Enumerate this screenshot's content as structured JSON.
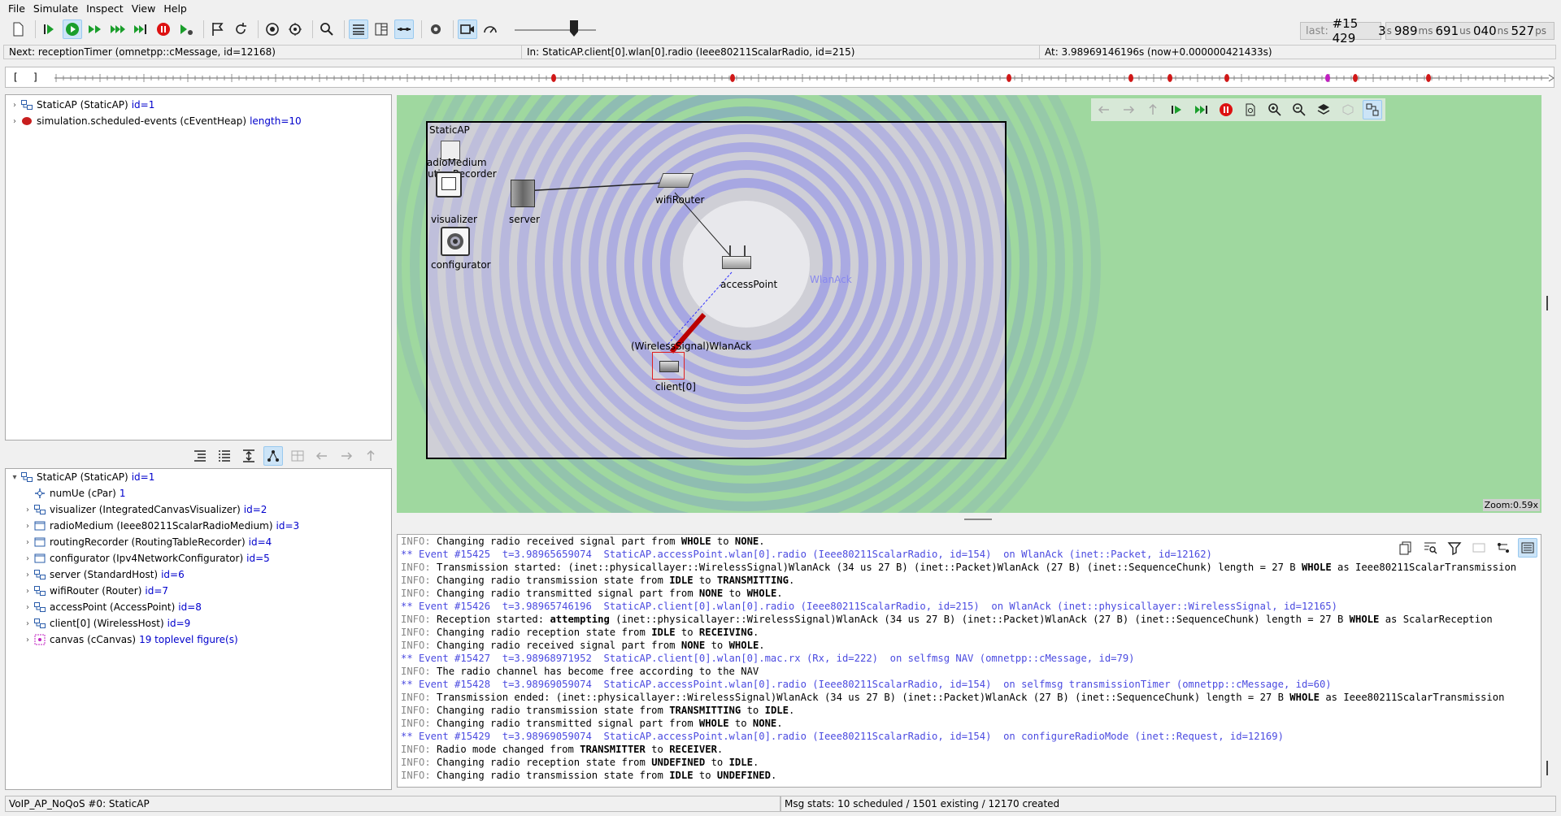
{
  "menu": [
    "File",
    "Simulate",
    "Inspect",
    "View",
    "Help"
  ],
  "counters": {
    "last_label": "last: ",
    "last_value": "#15 429",
    "t_s": "3",
    "t_ms": "989",
    "t_us": "691",
    "t_ns": "040",
    "t_ps": "527",
    "u_s": "s",
    "u_ms": "ms",
    "u_us": "us",
    "u_ns": "ns",
    "u_ps": "ps"
  },
  "status": {
    "next": "Next: receptionTimer (omnetpp::cMessage, id=12168)",
    "in": "In: StaticAP.client[0].wlan[0].radio (Ieee80211ScalarRadio, id=215)",
    "at": "At: 3.98969146196s (now+0.000000421433s)"
  },
  "timeline": {
    "open": "[",
    "close": "]"
  },
  "top_tree": [
    {
      "label": "StaticAP (StaticAP)",
      "id": "id=1",
      "icon": "module-icon"
    },
    {
      "label": "simulation.scheduled-events (cEventHeap)",
      "id": "length=10",
      "icon": "event-heap-icon"
    }
  ],
  "object_tree": {
    "root": {
      "label": "StaticAP (StaticAP)",
      "id": "id=1"
    },
    "children": [
      {
        "label": "numUe (cPar)",
        "id": "1",
        "icon": "param-icon",
        "expandable": false
      },
      {
        "label": "visualizer (IntegratedCanvasVisualizer)",
        "id": "id=2",
        "icon": "module-icon",
        "expandable": true
      },
      {
        "label": "radioMedium (Ieee80211ScalarRadioMedium)",
        "id": "id=3",
        "icon": "simple-module-icon",
        "expandable": true
      },
      {
        "label": "routingRecorder (RoutingTableRecorder)",
        "id": "id=4",
        "icon": "simple-module-icon",
        "expandable": true
      },
      {
        "label": "configurator (Ipv4NetworkConfigurator)",
        "id": "id=5",
        "icon": "simple-module-icon",
        "expandable": true
      },
      {
        "label": "server (StandardHost)",
        "id": "id=6",
        "icon": "module-icon",
        "expandable": true
      },
      {
        "label": "wifiRouter (Router)",
        "id": "id=7",
        "icon": "module-icon",
        "expandable": true
      },
      {
        "label": "accessPoint (AccessPoint)",
        "id": "id=8",
        "icon": "module-icon",
        "expandable": true
      },
      {
        "label": "client[0] (WirelessHost)",
        "id": "id=9",
        "icon": "module-icon",
        "expandable": true
      },
      {
        "label": "canvas (cCanvas)",
        "id": "19 toplevel figure(s)",
        "icon": "canvas-icon",
        "expandable": true
      }
    ]
  },
  "network": {
    "title": "StaticAP",
    "nodes": {
      "radioMedium": "radioMedium",
      "routingRecorder": "routingRecorder",
      "visualizer": "visualizer",
      "configurator": "configurator",
      "server": "server",
      "wifiRouter": "wifiRouter",
      "accessPoint": "accessPoint",
      "client": "client[0]"
    },
    "signal_label": "(WirelessSignal)WlanAck",
    "faded_label": "WlanAck",
    "zoom": "Zoom:0.59x"
  },
  "log": [
    {
      "type": "info",
      "text": "Changing radio received signal part from WHOLE to NONE."
    },
    {
      "type": "event",
      "text": "** Event #15425  t=3.98965659074  StaticAP.accessPoint.wlan[0].radio (Ieee80211ScalarRadio, id=154)  on WlanAck (inet::Packet, id=12162)"
    },
    {
      "type": "info",
      "text": "Transmission started: (inet::physicallayer::WirelessSignal)WlanAck (34 us 27 B) (inet::Packet)WlanAck (27 B) (inet::SequenceChunk) length = 27 B WHOLE as Ieee80211ScalarTransmission"
    },
    {
      "type": "info",
      "text": "Changing radio transmission state from IDLE to TRANSMITTING."
    },
    {
      "type": "info",
      "text": "Changing radio transmitted signal part from NONE to WHOLE."
    },
    {
      "type": "event",
      "text": "** Event #15426  t=3.98965746196  StaticAP.client[0].wlan[0].radio (Ieee80211ScalarRadio, id=215)  on WlanAck (inet::physicallayer::WirelessSignal, id=12165)"
    },
    {
      "type": "info",
      "text": "Reception started: attempting (inet::physicallayer::WirelessSignal)WlanAck (34 us 27 B) (inet::Packet)WlanAck (27 B) (inet::SequenceChunk) length = 27 B WHOLE as ScalarReception"
    },
    {
      "type": "info",
      "text": "Changing radio reception state from IDLE to RECEIVING."
    },
    {
      "type": "info",
      "text": "Changing radio received signal part from NONE to WHOLE."
    },
    {
      "type": "event",
      "text": "** Event #15427  t=3.98968971952  StaticAP.client[0].wlan[0].mac.rx (Rx, id=222)  on selfmsg NAV (omnetpp::cMessage, id=79)"
    },
    {
      "type": "info",
      "text": "The radio channel has become free according to the NAV"
    },
    {
      "type": "event",
      "text": "** Event #15428  t=3.98969059074  StaticAP.accessPoint.wlan[0].radio (Ieee80211ScalarRadio, id=154)  on selfmsg transmissionTimer (omnetpp::cMessage, id=60)"
    },
    {
      "type": "info",
      "text": "Transmission ended: (inet::physicallayer::WirelessSignal)WlanAck (34 us 27 B) (inet::Packet)WlanAck (27 B) (inet::SequenceChunk) length = 27 B WHOLE as Ieee80211ScalarTransmission"
    },
    {
      "type": "info",
      "text": "Changing radio transmission state from TRANSMITTING to IDLE."
    },
    {
      "type": "info",
      "text": "Changing radio transmitted signal part from WHOLE to NONE."
    },
    {
      "type": "event",
      "text": "** Event #15429  t=3.98969059074  StaticAP.accessPoint.wlan[0].radio (Ieee80211ScalarRadio, id=154)  on configureRadioMode (inet::Request, id=12169)"
    },
    {
      "type": "info",
      "text": "Radio mode changed from TRANSMITTER to RECEIVER."
    },
    {
      "type": "info",
      "text": "Changing radio reception state from UNDEFINED to IDLE."
    },
    {
      "type": "info",
      "text": "Changing radio transmission state from IDLE to UNDEFINED."
    }
  ],
  "log_prefix": "INFO:",
  "bottom": {
    "left": "VoIP_AP_NoQoS #0: StaticAP",
    "right": "Msg stats: 10 scheduled / 1501 existing / 12170 created"
  }
}
